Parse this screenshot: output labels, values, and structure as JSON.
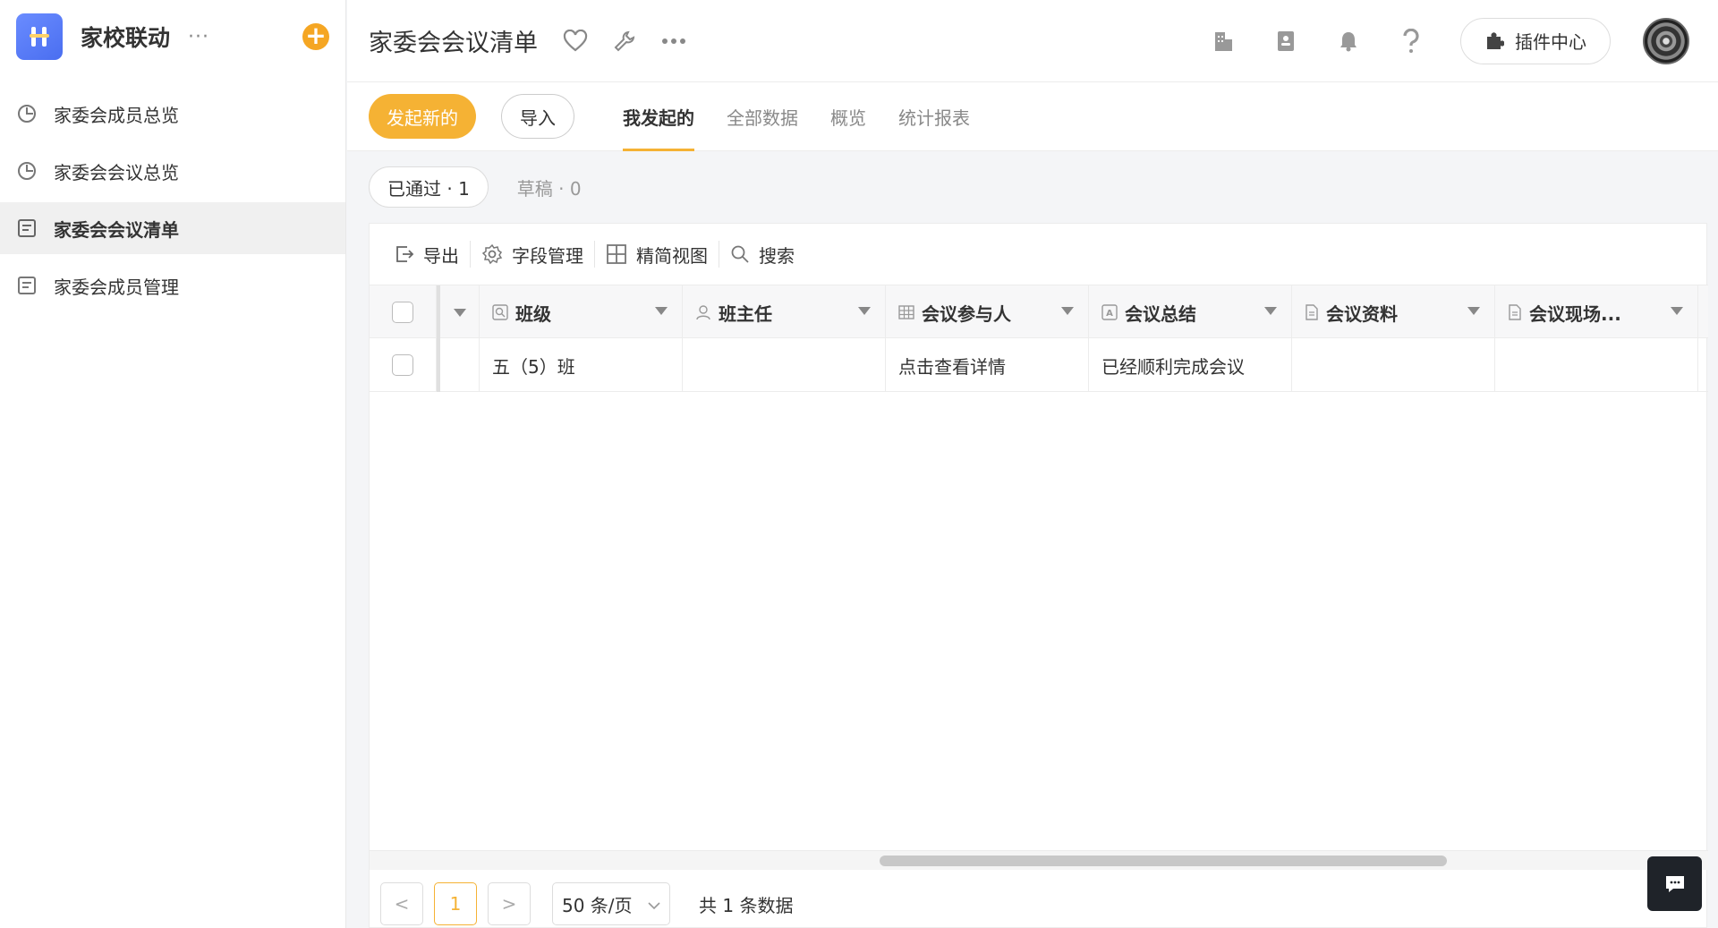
{
  "app": {
    "name": "家校联动",
    "more": "···",
    "add": "+"
  },
  "sidebar": {
    "items": [
      {
        "label": "家委会成员总览",
        "icon": "chart-pie-icon"
      },
      {
        "label": "家委会会议总览",
        "icon": "chart-pie-icon"
      },
      {
        "label": "家委会会议清单",
        "icon": "list-form-icon",
        "active": true
      },
      {
        "label": "家委会成员管理",
        "icon": "list-form-icon"
      }
    ]
  },
  "header": {
    "title": "家委会会议清单",
    "plugin_label": "插件中心"
  },
  "actions": {
    "new_label": "发起新的",
    "import_label": "导入"
  },
  "tabs": [
    {
      "label": "我发起的",
      "active": true
    },
    {
      "label": "全部数据"
    },
    {
      "label": "概览"
    },
    {
      "label": "统计报表"
    }
  ],
  "filters": {
    "approved": "已通过 · 1",
    "draft": "草稿 · 0"
  },
  "toolbar": {
    "export": "导出",
    "fields": "字段管理",
    "compact": "精简视图",
    "search": "搜索"
  },
  "table": {
    "columns": [
      "班级",
      "班主任",
      "会议参与人",
      "会议总结",
      "会议资料",
      "会议现场..."
    ],
    "rows": [
      [
        "五（5）班",
        "",
        "点击查看详情",
        "已经顺利完成会议",
        "",
        ""
      ]
    ]
  },
  "pagination": {
    "prev": "<",
    "current": "1",
    "next": ">",
    "page_size": "50 条/页",
    "total": "共 1 条数据"
  },
  "colors": {
    "accent": "#f5b234",
    "plus": "#f5a623",
    "logo": "#5b7cf7"
  }
}
